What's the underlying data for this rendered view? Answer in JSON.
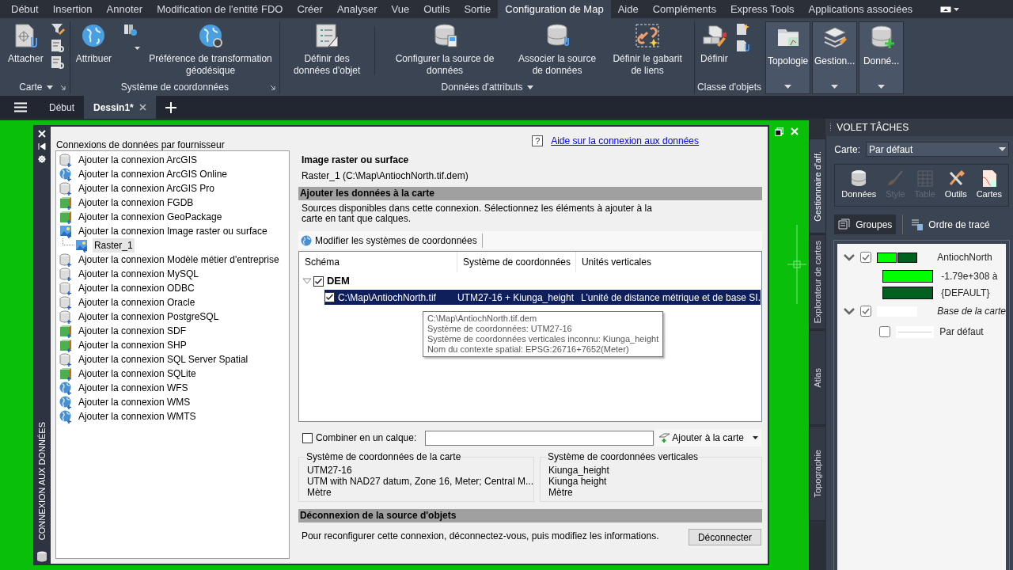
{
  "ribbon_tabs": [
    {
      "label": "Début",
      "selected": false
    },
    {
      "label": "Insertion",
      "selected": false
    },
    {
      "label": "Annoter",
      "selected": false
    },
    {
      "label": "Modification de l'entité FDO",
      "selected": false
    },
    {
      "label": "Créer",
      "selected": false
    },
    {
      "label": "Analyser",
      "selected": false
    },
    {
      "label": "Vue",
      "selected": false
    },
    {
      "label": "Outils",
      "selected": false
    },
    {
      "label": "Sortie",
      "selected": false
    },
    {
      "label": "Configuration de Map",
      "selected": true
    },
    {
      "label": "Aide",
      "selected": false
    },
    {
      "label": "Compléments",
      "selected": false
    },
    {
      "label": "Express Tools",
      "selected": false
    },
    {
      "label": "Applications associées",
      "selected": false
    }
  ],
  "ribbon_groups": [
    {
      "title": "Carte",
      "has_menu": true,
      "has_launcher": true,
      "items": [
        {
          "kind": "large",
          "label": "Attacher"
        },
        {
          "kind": "small"
        },
        {
          "kind": "small"
        },
        {
          "kind": "small"
        }
      ]
    },
    {
      "title": "Système de coordonnées",
      "has_menu": false,
      "has_launcher": true,
      "items": [
        {
          "kind": "large",
          "label": "Attribuer"
        },
        {
          "kind": "small_menu"
        },
        {
          "kind": "large",
          "label": "Préférence de transformation géodésique"
        }
      ]
    },
    {
      "title": "Données d'attributs",
      "has_menu": true,
      "has_launcher": false,
      "items": [
        {
          "kind": "large",
          "label": "Définir des données d'objet"
        },
        {
          "kind": "separator"
        },
        {
          "kind": "large",
          "label": "Configurer la source de données"
        },
        {
          "kind": "large",
          "label": "Associer la source de données"
        },
        {
          "kind": "large",
          "label": "Définir le gabarit de liens"
        }
      ]
    },
    {
      "title": "Classe d'objets",
      "has_menu": false,
      "has_launcher": false,
      "items": [
        {
          "kind": "large",
          "label": "Définir"
        },
        {
          "kind": "small"
        },
        {
          "kind": "small"
        }
      ]
    },
    {
      "items": [
        {
          "kind": "panel",
          "label": "Topologie"
        }
      ]
    },
    {
      "items": [
        {
          "kind": "panel",
          "label": "Gestion..."
        }
      ]
    },
    {
      "items": [
        {
          "kind": "panel",
          "label": "Donné..."
        }
      ]
    }
  ],
  "file_tabs": [
    {
      "label": "Début",
      "selected": false
    },
    {
      "label": "Dessin1*",
      "selected": true
    }
  ],
  "palette": {
    "title": "CONNEXION AUX DONNÉES",
    "providers_title": "Connexions de données par fournisseur",
    "providers": [
      {
        "kind": "database",
        "label": "Ajouter la connexion ArcGIS",
        "selected": false
      },
      {
        "kind": "globe",
        "label": "Ajouter la connexion ArcGIS Online",
        "selected": false
      },
      {
        "kind": "database",
        "label": "Ajouter la connexion ArcGIS Pro",
        "selected": false
      },
      {
        "kind": "cube",
        "label": "Ajouter la connexion FGDB",
        "selected": false
      },
      {
        "kind": "cube",
        "label": "Ajouter la connexion GeoPackage",
        "selected": false
      },
      {
        "kind": "raster",
        "label": "Ajouter la connexion Image raster ou surface",
        "selected": false,
        "children": [
          {
            "kind": "raster",
            "label": "Raster_1",
            "selected": true
          }
        ]
      },
      {
        "kind": "database",
        "label": "Ajouter la connexion Modèle métier d'entreprise",
        "selected": false
      },
      {
        "kind": "database",
        "label": "Ajouter la connexion MySQL",
        "selected": false
      },
      {
        "kind": "database",
        "label": "Ajouter la connexion ODBC",
        "selected": false
      },
      {
        "kind": "database",
        "label": "Ajouter la connexion Oracle",
        "selected": false
      },
      {
        "kind": "database",
        "label": "Ajouter la connexion PostgreSQL",
        "selected": false
      },
      {
        "kind": "cube",
        "label": "Ajouter la connexion SDF",
        "selected": false
      },
      {
        "kind": "cube",
        "label": "Ajouter la connexion SHP",
        "selected": false
      },
      {
        "kind": "database",
        "label": "Ajouter la connexion SQL Server Spatial",
        "selected": false
      },
      {
        "kind": "cube",
        "label": "Ajouter la connexion SQLite",
        "selected": false
      },
      {
        "kind": "globe",
        "label": "Ajouter la connexion WFS",
        "selected": false
      },
      {
        "kind": "globe",
        "label": "Ajouter la connexion WMS",
        "selected": false
      },
      {
        "kind": "globe",
        "label": "Ajouter la connexion WMTS",
        "selected": false
      }
    ],
    "help_mark": "?",
    "help_link": "Aide sur la connexion aux données",
    "source_type": "Image raster ou surface",
    "source_name": "Raster_1 (C:\\Map\\AntiochNorth.tif.dem)",
    "add_section": "Ajouter les données à la carte",
    "add_description": "Sources disponibles dans cette connexion. Sélectionnez les éléments à ajouter à la carte en tant que calques.",
    "modify_button": "Modifier les systèmes de coordonnées",
    "columns": [
      "Schéma",
      "Système de coordonnées",
      "Unités verticales"
    ],
    "schemas": [
      {
        "name": "DEM",
        "checked": true,
        "expanded": true,
        "rows": [
          {
            "cells": [
              "C:\\Map\\AntiochNorth.tif",
              "UTM27-16 + Kiunga_height",
              "L'unité de distance métrique et de base SI."
            ],
            "checked": true,
            "selected": true
          }
        ]
      }
    ],
    "tooltip": [
      "C:\\Map\\AntiochNorth.tif.dem",
      "Système de coordonnées: UTM27-16",
      "Système de coordonnées verticales inconnu: Kiunga_height",
      "Nom du contexte spatial: EPSG:26716+7652(Meter)"
    ],
    "combine": {
      "label": "Combiner en un calque:",
      "checked": false
    },
    "add_button": "Ajouter à la carte",
    "map_cs": {
      "title": "Système de coordonnées de la carte",
      "lines": [
        "UTM27-16",
        "UTM with NAD27 datum, Zone 16, Meter; Central M...",
        "Mètre"
      ]
    },
    "vertical_cs": {
      "title": "Système de coordonnées verticales",
      "lines": [
        "Kiunga_height",
        "Kiunga height",
        "Mètre"
      ]
    },
    "disconnect_section": "Déconnexion de la source d'objets",
    "disconnect_text": "Pour reconfigurer cette connexion, déconnectez-vous, puis modifiez les informations.",
    "disconnect_button": "Déconnecter"
  },
  "task_pane": {
    "title": "VOLET TÂCHES",
    "side_tabs": [
      {
        "label": "Gestionnaire d'aff.",
        "selected": true
      },
      {
        "label": "Explorateur de cartes",
        "selected": false
      },
      {
        "label": "Atlas",
        "selected": false
      },
      {
        "label": "Topographie",
        "selected": false
      }
    ],
    "map_label": "Carte:",
    "map_value": "Par défaut",
    "tools": [
      {
        "label": "Données",
        "disabled": false
      },
      {
        "label": "Style",
        "disabled": true
      },
      {
        "label": "Table",
        "disabled": true
      },
      {
        "label": "Outils",
        "disabled": false
      },
      {
        "label": "Cartes",
        "disabled": false
      }
    ],
    "views": [
      {
        "label": "Groupes",
        "selected": true
      },
      {
        "label": "Ordre de tracé",
        "selected": false
      }
    ],
    "layers": [
      {
        "name": "AntiochNorth",
        "checked": true,
        "expanded": true,
        "italic": false,
        "children": [
          {
            "kind": "swatch",
            "label": "-1.79e+308 à",
            "color": "#00ff00"
          },
          {
            "kind": "swatch",
            "label": "{DEFAULT}",
            "color": "#006020"
          }
        ]
      },
      {
        "name": "Base de la carte",
        "checked": true,
        "expanded": true,
        "italic": true,
        "children": [
          {
            "kind": "line",
            "label": "Par défaut",
            "checked": false
          }
        ]
      }
    ]
  }
}
